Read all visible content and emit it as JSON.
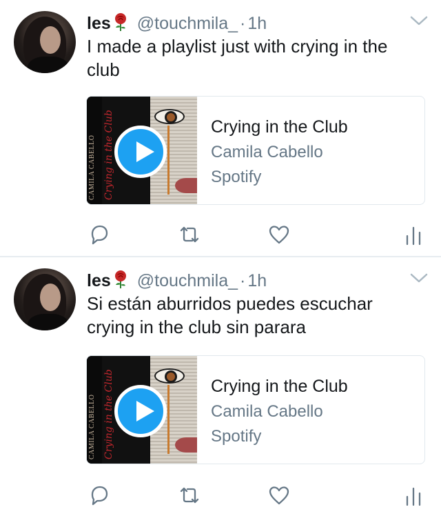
{
  "tweets": [
    {
      "user": {
        "name": "les",
        "emoji_icon": "rose-emoji",
        "handle": "@touchmila_",
        "separator": "·",
        "time": "1h"
      },
      "text": "I made a playlist just with crying in the club",
      "card": {
        "title": "Crying in the Club",
        "artist": "Camila Cabello",
        "source": "Spotify",
        "art_band_text": "CAMILA CABELLO",
        "art_script_text": "Crying in the Club"
      }
    },
    {
      "user": {
        "name": "les",
        "emoji_icon": "rose-emoji",
        "handle": "@touchmila_",
        "separator": "·",
        "time": "1h"
      },
      "text": "Si están aburridos puedes escuchar crying in the club sin parara",
      "card": {
        "title": "Crying in the Club",
        "artist": "Camila Cabello",
        "source": "Spotify",
        "art_band_text": "CAMILA CABELLO",
        "art_script_text": "Crying in the Club"
      }
    }
  ],
  "icons": {
    "reply": "reply-icon",
    "retweet": "retweet-icon",
    "like": "heart-icon",
    "stats": "analytics-icon",
    "menu": "chevron-down-icon",
    "play": "play-icon"
  },
  "colors": {
    "accent": "#1da1f2",
    "secondary_text": "#657786",
    "primary_text": "#14171a",
    "divider": "#e6ecf0",
    "icon": "#657786"
  }
}
